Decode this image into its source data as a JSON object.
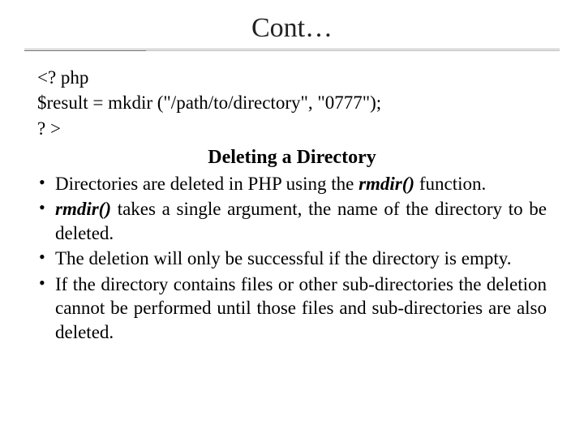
{
  "title": "Cont…",
  "code": {
    "line1": "<? php",
    "line2": "$result = mkdir (\"/path/to/directory\", \"0777\");",
    "line3": "? >"
  },
  "subheading": "Deleting a Directory",
  "bullets": [
    {
      "pre": "Directories are deleted in PHP using the ",
      "func": "rmdir()",
      "post": " function."
    },
    {
      "func": "rmdir()",
      "post": " takes a single argument, the name of the directory to be deleted."
    },
    {
      "text": "The deletion will only be successful if the directory is empty."
    },
    {
      "text": "If the directory contains files or other sub-directories the deletion cannot be performed until those files and sub-directories are also deleted."
    }
  ]
}
